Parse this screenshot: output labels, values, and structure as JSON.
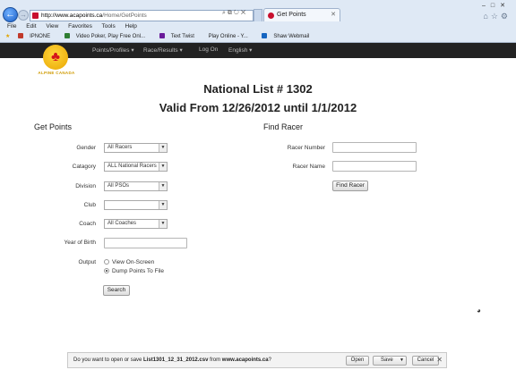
{
  "browser": {
    "address": {
      "host": "http://www.acapoints.ca",
      "path": "/Home/GetPoints"
    },
    "tab": {
      "title": "Get Points"
    },
    "menu": [
      "File",
      "Edit",
      "View",
      "Favorites",
      "Tools",
      "Help"
    ],
    "favorites": [
      "IPNONE",
      "Video Poker, Play Free Onl...",
      "Text Twist",
      "Play Online - Y...",
      "Shaw Webmail"
    ]
  },
  "site": {
    "logo_text": "ALPINE CANADA",
    "nav": [
      "Points/Profiles ▾",
      "Race/Results ▾",
      "Log On",
      "English ▾"
    ]
  },
  "page": {
    "title_line1": "National List # 1302",
    "title_line2": "Valid From 12/26/2012 until 1/1/2012"
  },
  "get_points": {
    "title": "Get Points",
    "gender": {
      "label": "Gender",
      "value": "All Racers"
    },
    "category": {
      "label": "Catagory",
      "value": "ALL National Racers"
    },
    "division": {
      "label": "Division",
      "value": "All PSOs"
    },
    "club": {
      "label": "Club",
      "value": ""
    },
    "coach": {
      "label": "Coach",
      "value": "All Coaches"
    },
    "year_of_birth": {
      "label": "Year of Birth",
      "value": ""
    },
    "output": {
      "label": "Output",
      "options": [
        {
          "label": "View On-Screen",
          "selected": false
        },
        {
          "label": "Dump Points To File",
          "selected": true
        }
      ]
    },
    "search_button": "Search"
  },
  "find_racer": {
    "title": "Find Racer",
    "racer_number_label": "Racer Number",
    "racer_name_label": "Racer Name",
    "button": "Find Racer"
  },
  "download_bar": {
    "prefix": "Do you want to open or save ",
    "filename": "List1301_12_31_2012.csv",
    "middle": " from ",
    "source": "www.acapoints.ca",
    "suffix": "?",
    "open": "Open",
    "save": "Save",
    "cancel": "Cancel"
  }
}
